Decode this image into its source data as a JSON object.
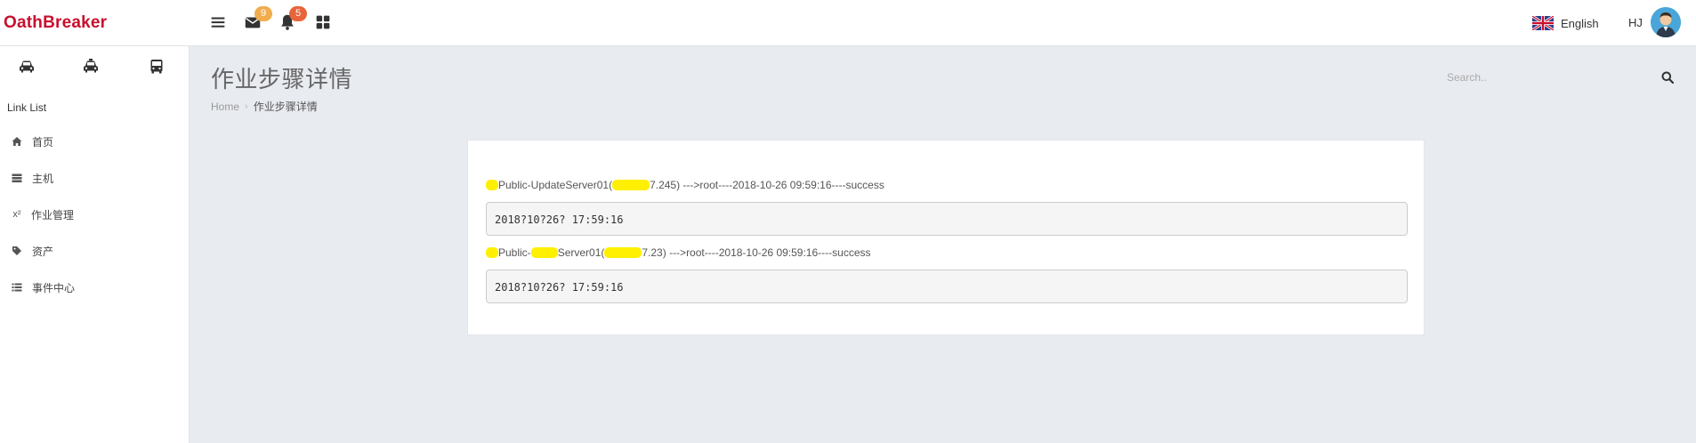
{
  "header": {
    "brand": "OathBreaker",
    "mail_badge": "9",
    "bell_badge": "5",
    "language": "English",
    "user_initials": "HJ",
    "colors": {
      "brand": "#c8102e",
      "mail_badge": "#f0ad4e",
      "bell_badge": "#e8643a"
    },
    "icons": [
      "menu-icon",
      "mail-icon",
      "bell-icon",
      "grid-icon",
      "uk-flag-icon",
      "avatar"
    ]
  },
  "sidebar": {
    "vehicle_icons": [
      "car-icon",
      "taxi-icon",
      "bus-icon"
    ],
    "section_title": "Link List",
    "items": [
      {
        "label": "首页",
        "icon": "home-icon"
      },
      {
        "label": "主机",
        "icon": "server-icon"
      },
      {
        "label": "作业管理",
        "icon": "superscript-icon",
        "icon_text": "x²"
      },
      {
        "label": "资产",
        "icon": "tag-icon"
      },
      {
        "label": "事件中心",
        "icon": "list-icon"
      }
    ]
  },
  "page": {
    "title": "作业步骤详情",
    "breadcrumb": {
      "home": "Home",
      "separator": "›",
      "current": "作业步骤详情"
    }
  },
  "search": {
    "placeholder": "Search.."
  },
  "steps": [
    {
      "host_prefix": "Public-UpdateServer01(",
      "ip_tail": "7.245)",
      "suffix": " --->root----2018-10-26 09:59:16----success",
      "output": "2018?10?26? 17:59:16"
    },
    {
      "host_prefix": "Public-",
      "host_mid": "Server01(",
      "ip_tail": "7.23)",
      "suffix": " --->root----2018-10-26 09:59:16----success",
      "output": "2018?10?26? 17:59:16"
    }
  ]
}
